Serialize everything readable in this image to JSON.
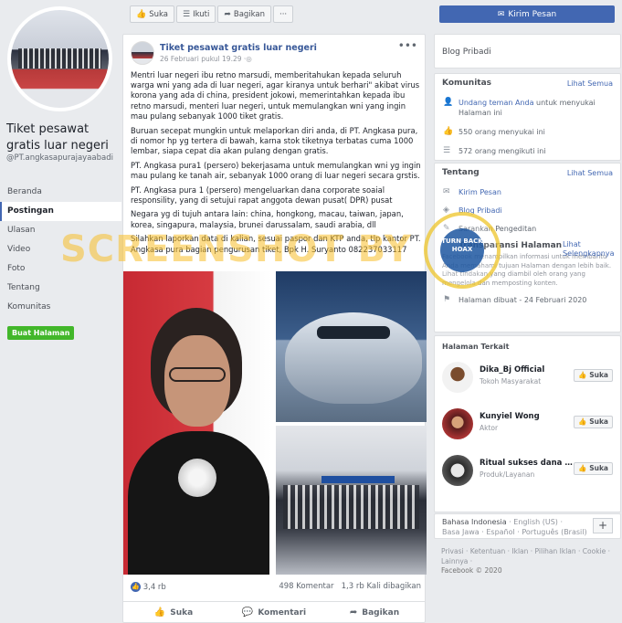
{
  "page": {
    "name": "Tiket pesawat gratis luar negeri",
    "handle": "@PT.angkasapurajayaabadi",
    "nav": [
      "Beranda",
      "Postingan",
      "Ulasan",
      "Video",
      "Foto",
      "Tentang",
      "Komunitas"
    ],
    "active_nav": "Postingan",
    "create_page_label": "Buat Halaman"
  },
  "actions": {
    "like": "Suka",
    "follow": "Ikuti",
    "share": "Bagikan",
    "more": "···",
    "send_message": "Kirim Pesan"
  },
  "post": {
    "author": "Tiket pesawat gratis luar negeri",
    "timestamp": "26 Februari pukul 19.29",
    "paragraphs": [
      "Mentri luar negeri ibu retno marsudi, memberitahukan kepada seluruh warga wni yang ada di luar negeri, agar kiranya untuk berhari\" akibat virus korona yang ada di china, president jokowi, memerintahkan kepada ibu retno marsudi, menteri luar negeri, untuk memulangkan wni yang ingin mau pulang sebanyak 1000 tiket gratis.",
      "Buruan secepat mungkin untuk melaporkan diri anda, di PT. Angkasa pura, di nomor hp yg tertera di bawah, karna stok tiketnya terbatas cuma 1000 lembar, siapa cepat dia akan pulang dengan gratis.",
      "PT. Angkasa pura1 (persero) bekerjasama untuk memulangkan wni yg ingin mau pulang ke tanah air, sebanyak 1000 orang di luar negeri secara grstis.",
      "PT. Angkasa pura 1 (persero) mengeluarkan dana corporate soaial responsility, yang di setujui rapat anggota dewan pusat( DPR) pusat",
      "Negara yg di tujuh antara lain: china, hongkong, macau, taiwan, japan, korea, singapura, malaysia, brunei darussalam, saudi arabia, dll",
      "Silahkan laporkan data di kalian, sesuai paspor dan KTP anda, tlp kantor PT. Angkasa pura bagian pengurusan tiket, Bpk H. Suryanto 082237033117"
    ],
    "reactions": "3,4 rb",
    "comments": "498 Komentar",
    "shares": "1,3 rb Kali dibagikan",
    "btn_like": "Suka",
    "btn_comment": "Komentari",
    "btn_share": "Bagikan"
  },
  "sidebar": {
    "blog": "Blog Pribadi",
    "community": {
      "title": "Komunitas",
      "see_all": "Lihat Semua",
      "invite_link": "Undang teman Anda",
      "invite_text": " untuk menyukai Halaman ini",
      "likes": "550 orang menyukai ini",
      "follows": "572 orang mengikuti ini"
    },
    "about": {
      "title": "Tentang",
      "see_all": "Lihat Semua",
      "message": "Kirim Pesan",
      "category": "Blog Pribadi",
      "suggest": "Sarankan Pengeditan"
    },
    "transparency": {
      "title": "Transparansi Halaman",
      "see_more": "Lihat Selengkapnya",
      "desc": "Facebook menampilkan informasi untuk membantu Anda memahami tujuan Halaman dengan lebih baik. Lihat tindakan yang diambil oleh orang yang mengelola dan memposting konten.",
      "created": "Halaman dibuat - 24 Februari 2020"
    },
    "related": {
      "title": "Halaman Terkait",
      "like_label": "Suka",
      "items": [
        {
          "name": "Dika_Bj Official",
          "sub": "Tokoh Masyarakat"
        },
        {
          "name": "Kunyiel Wong",
          "sub": "Aktor"
        },
        {
          "name": "Ritual sukses dana gois",
          "sub": "Produk/Layanan"
        }
      ]
    },
    "languages": {
      "current": "Bahasa Indonesia",
      "others_line1": " · English (US) ·",
      "line2": "Basa Jawa · Español · Português (Brasil)",
      "plus": "+"
    },
    "footer": {
      "links": "Privasi · Ketentuan · Iklan · Pilihan Iklan · Cookie · Lainnya ·",
      "copyright": "Facebook © 2020"
    }
  },
  "watermark": {
    "text": "SCREENSHOT BY",
    "seal": "TURN BACK HOAX",
    "seal_ring": "MASYARAKAT ANTI FITNAH INDONESIA"
  },
  "colors": {
    "brand": "#4267b2",
    "background": "#e9ebee",
    "create_button": "#42b72a",
    "watermark": "#f7be28"
  }
}
